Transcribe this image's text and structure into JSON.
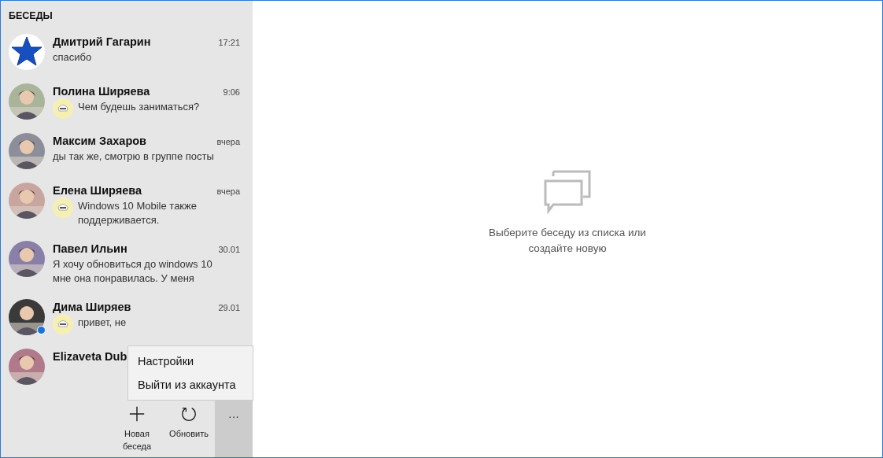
{
  "sidebar": {
    "title": "БЕСЕДЫ",
    "conversations": [
      {
        "name": "Дмитрий Гагарин",
        "time": "17:21",
        "preview": "спасибо",
        "kind": "star",
        "sticker": false,
        "online": false
      },
      {
        "name": "Полина Ширяева",
        "time": "9:06",
        "preview": "Чем будешь заниматься?",
        "kind": "picture",
        "sticker": true,
        "online": false
      },
      {
        "name": "Максим Захаров",
        "time": "вчера",
        "preview": "ды так же, смотрю в группе посты",
        "kind": "picture",
        "sticker": false,
        "online": false
      },
      {
        "name": "Елена Ширяева",
        "time": "вчера",
        "preview": "Windows 10 Mobile также поддерживается.",
        "kind": "picture",
        "sticker": true,
        "online": false
      },
      {
        "name": "Павел Ильин",
        "time": "30.01",
        "preview": "Я хочу обновиться до windows 10 мне она понравилась. У меня",
        "kind": "picture",
        "sticker": false,
        "online": false
      },
      {
        "name": "Дима Ширяев",
        "time": "29.01",
        "preview": "привет, не",
        "kind": "picture",
        "sticker": true,
        "online": true,
        "color": "#1a73d9"
      },
      {
        "name": "Elizaveta Dub",
        "kind": "picture",
        "sticker": false,
        "online": false
      }
    ],
    "toolbar": [
      {
        "kind": "add",
        "label": "Новая беседа",
        "selected": false
      },
      {
        "kind": "refresh",
        "label": "Обновить",
        "selected": false
      },
      {
        "kind": "more",
        "label": "···",
        "selected": true
      }
    ],
    "menu": [
      "Настройки",
      "Выйти из аккаунта"
    ]
  },
  "main": {
    "empty_message": "Выберите беседу из списка или создайте новую"
  }
}
